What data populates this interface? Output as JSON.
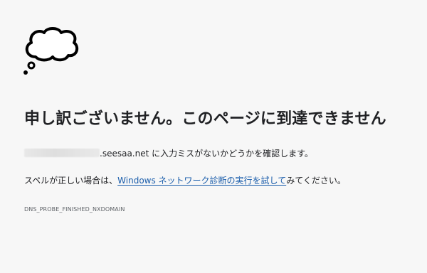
{
  "icon": "thought-bubble-cloud-icon",
  "title": "申し訳ございません。このページに到達できません",
  "message": {
    "host_suffix": ".seesaa.net",
    "text": " に入力ミスがないかどうかを確認します。"
  },
  "suggestion": {
    "before": "スペルが正しい場合は、",
    "link": "Windows ネットワーク診断の実行を試して",
    "after": "みてください。"
  },
  "error_code": "DNS_PROBE_FINISHED_NXDOMAIN",
  "colors": {
    "background": "#f7f7f7",
    "text": "#202124",
    "link": "#1a5dab",
    "muted": "#5f6368"
  }
}
